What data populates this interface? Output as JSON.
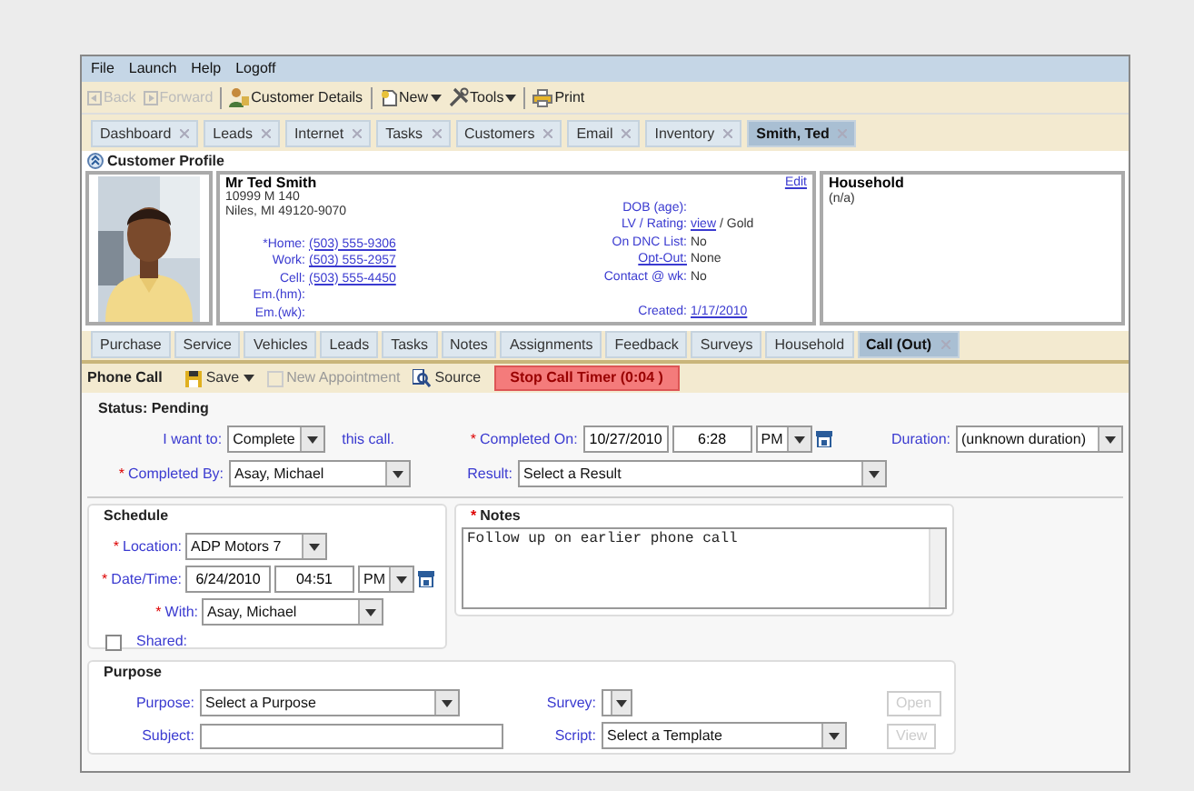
{
  "menu": [
    "File",
    "Launch",
    "Help",
    "Logoff"
  ],
  "toolbar": [
    {
      "kind": "button",
      "label": "Back",
      "disabled": true
    },
    {
      "kind": "button",
      "label": "Forward",
      "disabled": true
    },
    {
      "kind": "separator"
    },
    {
      "kind": "button",
      "label": "Customer Details",
      "disabled": false
    },
    {
      "kind": "separator"
    },
    {
      "kind": "menu",
      "label": "New",
      "disabled": false
    },
    {
      "kind": "menu",
      "label": "Tools",
      "disabled": false
    },
    {
      "kind": "separator"
    },
    {
      "kind": "button",
      "label": "Print",
      "disabled": false
    }
  ],
  "tabs": [
    {
      "label": "Dashboard",
      "selected": false
    },
    {
      "label": "Leads",
      "selected": false
    },
    {
      "label": "Internet",
      "selected": false
    },
    {
      "label": "Tasks",
      "selected": false
    },
    {
      "label": "Customers",
      "selected": false
    },
    {
      "label": "Email",
      "selected": false
    },
    {
      "label": "Inventory",
      "selected": false
    },
    {
      "label": "Smith, Ted",
      "selected": true
    }
  ],
  "profile": {
    "title": "Customer Profile",
    "name": "Mr  Ted Smith",
    "address": [
      "10999 M 140",
      "Niles, MI 49120-9070"
    ],
    "edit": "Edit",
    "contacts": [
      {
        "label": "*Home:",
        "value": "(503) 555-9306"
      },
      {
        "label": "Work:",
        "value": "(503) 555-2957"
      },
      {
        "label": "Cell:",
        "value": "(503) 555-4450"
      },
      {
        "label": "Em.(hm):"
      },
      {
        "label": "Em.(wk):"
      }
    ],
    "details": [
      {
        "label": "DOB (age):",
        "label_link": false
      },
      {
        "label": "LV / Rating:",
        "label_link": false,
        "link": "view",
        "value": "/ Gold"
      },
      {
        "label": "On DNC List:",
        "label_link": false,
        "value": "No"
      },
      {
        "label": "Opt-Out:",
        "label_link": true,
        "value": "None"
      },
      {
        "label": "Contact @ wk:",
        "label_link": false,
        "value": "No"
      },
      {
        "label": "Created:",
        "label_link": false,
        "link": "1/17/2010"
      }
    ]
  },
  "household": {
    "title": "Household",
    "value": "(n/a)"
  },
  "subtabs": [
    {
      "label": "Purchase",
      "selected": false
    },
    {
      "label": "Service",
      "selected": false
    },
    {
      "label": "Vehicles",
      "selected": false
    },
    {
      "label": "Leads",
      "selected": false
    },
    {
      "label": "Tasks",
      "selected": false
    },
    {
      "label": "Notes",
      "selected": false
    },
    {
      "label": "Assignments",
      "selected": false
    },
    {
      "label": "Feedback",
      "selected": false
    },
    {
      "label": "Surveys",
      "selected": false
    },
    {
      "label": "Household",
      "selected": false
    },
    {
      "label": "Call (Out)",
      "selected": true
    }
  ],
  "call_bar": {
    "title": "Phone Call",
    "actions": [
      {
        "kind": "menu",
        "label": "Save",
        "disabled": false
      },
      {
        "kind": "button",
        "label": "New Appointment",
        "disabled": true
      },
      {
        "kind": "button",
        "label": "Source",
        "disabled": false
      }
    ],
    "timer": "Stop Call Timer (0:04 )"
  },
  "status": {
    "title": "Status: Pending",
    "i_want_to": {
      "label": "I want to:",
      "value": "Complete",
      "suffix": "this call."
    },
    "completed_on": {
      "marker": "*",
      "label": "Completed On:",
      "date": "10/27/2010",
      "time": "6:28",
      "ampm": "PM"
    },
    "duration": {
      "label": "Duration:",
      "value": "(unknown duration)"
    },
    "completed_by": {
      "marker": "*",
      "label": "Completed By:",
      "value": "Asay, Michael"
    },
    "result": {
      "label": "Result:",
      "value": "Select a Result"
    }
  },
  "schedule": {
    "title": "Schedule",
    "location": {
      "marker": "*",
      "label": "Location:",
      "value": "ADP Motors 7"
    },
    "datetime": {
      "marker": "*",
      "label": "Date/Time:",
      "date": "6/24/2010",
      "time": "04:51",
      "ampm": "PM"
    },
    "with": {
      "marker": "*",
      "label": "With:",
      "value": "Asay, Michael"
    },
    "shared": {
      "label": "Shared:",
      "checked": false
    }
  },
  "notes": {
    "marker": "*",
    "title": "Notes",
    "value": "Follow up on earlier phone call"
  },
  "purpose": {
    "title": "Purpose",
    "purpose": {
      "label": "Purpose:",
      "value": "Select a Purpose"
    },
    "survey": {
      "label": "Survey:"
    },
    "open": {
      "label": "Open",
      "disabled": true
    },
    "subject": {
      "label": "Subject:"
    },
    "script": {
      "label": "Script:",
      "value": "Select a Template"
    },
    "view": {
      "label": "View",
      "disabled": true
    }
  }
}
